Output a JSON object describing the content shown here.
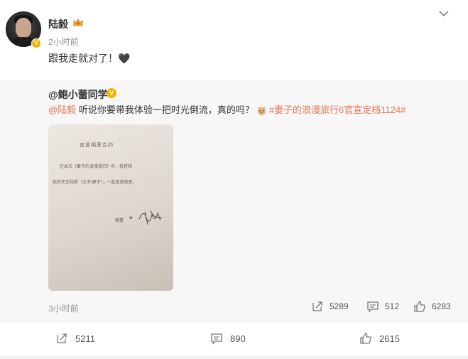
{
  "post": {
    "author": "陆毅",
    "time": "2小时前",
    "text": "跟我走就对了！🖤"
  },
  "retweet": {
    "author": "@鲍小蕾同学",
    "mention": "@陆毅",
    "body": " 听说你要带我体验一把时光倒流，真的吗？",
    "hashtag": "#妻子的浪漫旅行6官宣定档1124#",
    "photo": {
      "title": "宣逃相恶合约",
      "line1": "在本次《妻子的浪漫旅行》中，我将和",
      "line2": "我的先生陆毅（丈夫/妻子），一起宣逃相恶。",
      "signature": "鲍蕾"
    },
    "time": "3小时前",
    "reposts": "5289",
    "comments": "512",
    "likes": "6283"
  },
  "actions": {
    "reposts": "5211",
    "comments": "890",
    "likes": "2615"
  },
  "colors": {
    "accent_orange": "#eb7350",
    "verified_gold": "#f5b300"
  },
  "icons": [
    "crown-icon",
    "chevron-down-icon",
    "verified-badge-icon",
    "repost-icon",
    "comment-icon",
    "like-icon",
    "cat-emoji-icon"
  ]
}
